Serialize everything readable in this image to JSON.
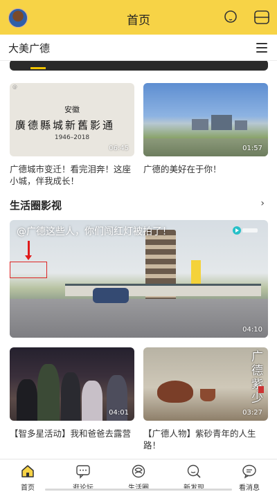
{
  "header": {
    "title": "首页",
    "avatar_icon": "avatar",
    "search_icon": "search-icon",
    "scan_icon": "scan-icon",
    "accent": "#f7d346"
  },
  "subheader": {
    "name": "大美广德",
    "menu_icon": "menu-icon"
  },
  "top_videos": [
    {
      "duration": "06:45",
      "caption": "广德城市变迁！看完泪奔！这座小城，伴我成长！",
      "thumb_header": "安徽",
      "thumb_title": "廣德縣城新舊影通",
      "thumb_years": "1946–2018"
    },
    {
      "duration": "01:57",
      "caption": "广德的美好在于你！"
    }
  ],
  "section": {
    "title": "生活圈影视",
    "more": "›"
  },
  "featured": {
    "overlay_text": "@广德这些人，你们闯红灯被拍了！",
    "duration": "04:10"
  },
  "bottom_videos": [
    {
      "duration": "04:01",
      "caption": "【智多星活动】我和爸爸去露营"
    },
    {
      "duration": "03:27",
      "caption": "【广德人物】紫砂青年的人生路！",
      "thumb_vertical_text": "广德紫少"
    }
  ],
  "tabs": [
    {
      "label": "首页",
      "icon": "home-icon",
      "active": true
    },
    {
      "label": "逛论坛",
      "icon": "forum-icon"
    },
    {
      "label": "生活圈",
      "icon": "life-circle-icon"
    },
    {
      "label": "新发现",
      "icon": "discover-icon"
    },
    {
      "label": "看消息",
      "icon": "message-icon"
    }
  ]
}
